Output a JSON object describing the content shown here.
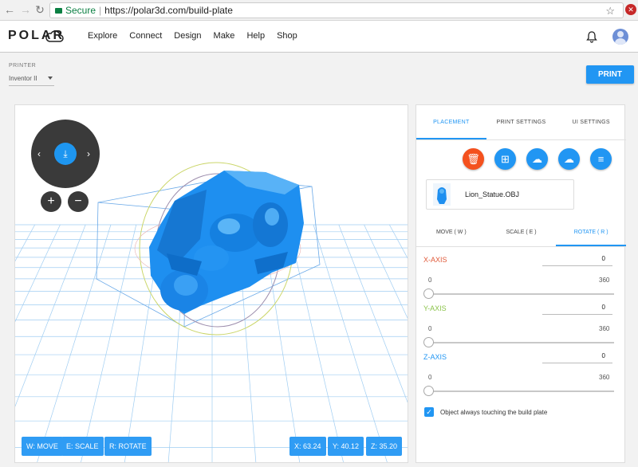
{
  "browser": {
    "secure_label": "Secure",
    "url": "https://polar3d.com/build-plate"
  },
  "header": {
    "logo": "POLAR",
    "nav": [
      "Explore",
      "Connect",
      "Design",
      "Make",
      "Help",
      "Shop"
    ]
  },
  "toolbar": {
    "printer_label": "PRINTER",
    "printer_value": "Inventor II",
    "print_label": "PRINT"
  },
  "viewport": {
    "chips_left": [
      "W: MOVE",
      "E: SCALE",
      "R: ROTATE"
    ],
    "coords": [
      "X: 63.24",
      "Y: 40.12",
      "Z: 35.20"
    ]
  },
  "panel": {
    "tabs": [
      "PLACEMENT",
      "PRINT SETTINGS",
      "UI SETTINGS"
    ],
    "file_name": "Lion_Statue.OBJ",
    "subtabs": [
      "MOVE ( W )",
      "SCALE ( E )",
      "ROTATE ( R )"
    ],
    "axes": [
      {
        "label": "X-AXIS",
        "value": "0",
        "min": "0",
        "max": "360",
        "color": "#e05a3a"
      },
      {
        "label": "Y-AXIS",
        "value": "0",
        "min": "0",
        "max": "360",
        "color": "#8bc34a"
      },
      {
        "label": "Z-AXIS",
        "value": "0",
        "min": "0",
        "max": "360",
        "color": "#2196f3"
      }
    ],
    "checkbox_label": "Object always touching the build plate"
  },
  "colors": {
    "accent": "#2196f3",
    "delete": "#f4511e"
  }
}
